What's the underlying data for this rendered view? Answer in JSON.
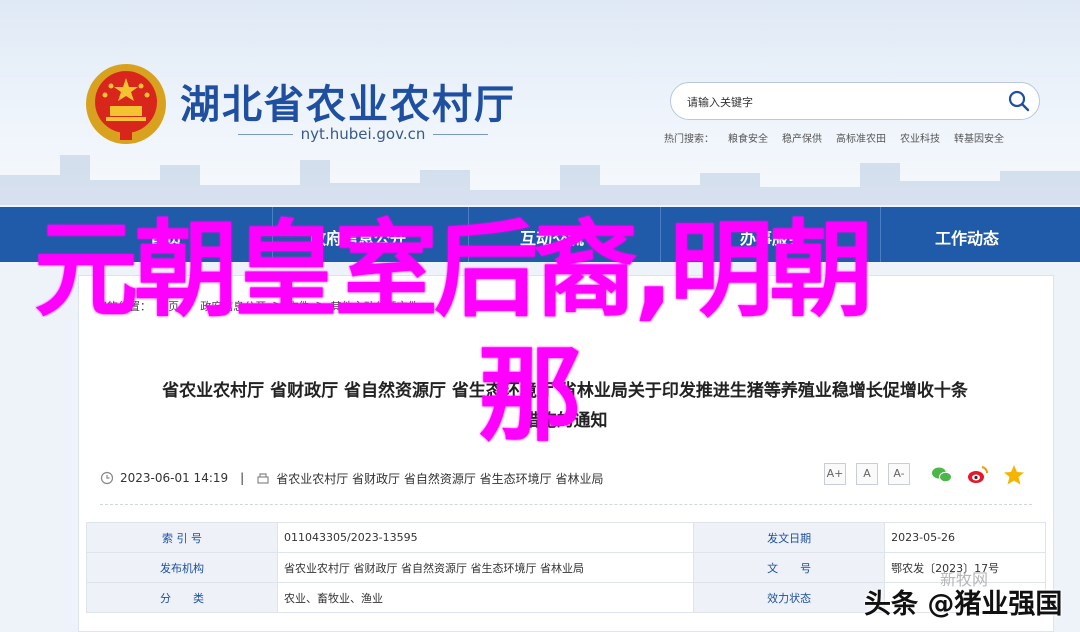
{
  "header": {
    "site_title": "湖北省农业农村厅",
    "domain": "nyt.hubei.gov.cn"
  },
  "search": {
    "placeholder": "请输入关键字",
    "hot_label": "热门搜索：",
    "hot_terms": [
      "粮食安全",
      "稳产保供",
      "高标准农田",
      "农业科技",
      "转基因安全"
    ]
  },
  "nav": {
    "items": [
      "首页",
      "政府信息公开",
      "互动交流",
      "办事服务",
      "工作动态"
    ]
  },
  "breadcrumb": {
    "items": [
      "您的位置：",
      "首页",
      ">",
      "政府信息公开",
      ">",
      "文件",
      ">",
      "其他主动公开文件"
    ]
  },
  "article": {
    "title_line1": "省农业农村厅 省财政厅 省自然资源厅 省生态环境厅 省林业局关于印发推进生猪等养殖业稳增长促增收十条",
    "title_line2": "措施的通知",
    "date": "2023-06-01 14:19",
    "separator": "|",
    "sources": "省农业农村厅 省财政厅 省自然资源厅 省生态环境厅 省林业局",
    "font_sizes": [
      "A+",
      "A",
      "A-"
    ]
  },
  "info_table": {
    "rows": [
      {
        "l1": "索 引 号",
        "v1": "011043305/2023-13595",
        "l2": "发文日期",
        "v2": "2023-05-26"
      },
      {
        "l1": "发布机构",
        "v1": "省农业农村厅 省财政厅 省自然资源厅 省生态环境厅 省林业局",
        "l2": "文　　号",
        "v2": "鄂农发〔2023〕17号"
      },
      {
        "l1": "分　　类",
        "v1": "农业、畜牧业、渔业",
        "l2": "效力状态",
        "v2": ""
      }
    ]
  },
  "overlay": {
    "line1": "元朝皇室后裔,明朝",
    "line2": "那"
  },
  "watermark": {
    "text": "头条 @猪业强国",
    "faint": "新牧网"
  },
  "colors": {
    "brand_blue": "#1f5ba8",
    "overlay_magenta": "#ff00ff"
  }
}
